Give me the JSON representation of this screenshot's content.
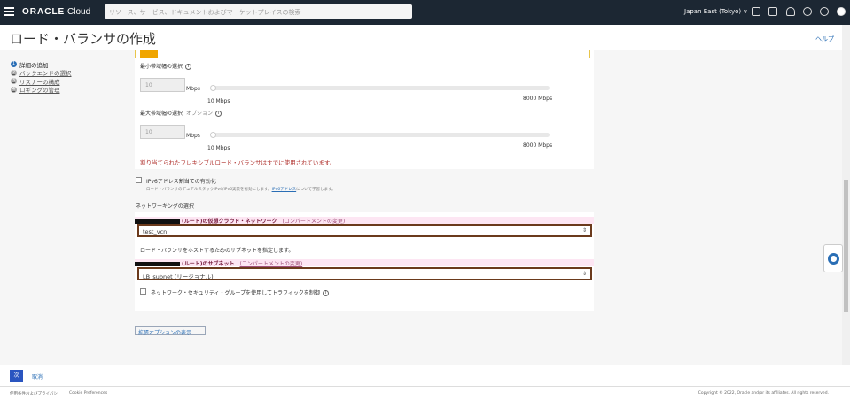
{
  "header": {
    "brand_bold": "ORACLE",
    "brand_light": "Cloud",
    "search_placeholder": "リソース、サービス、ドキュメントおよびマーケットプレイスの検索",
    "region": "Japan East (Tokyo) ∨"
  },
  "page": {
    "title": "ロード・バランサの作成",
    "help": "ヘルプ"
  },
  "steps": [
    {
      "n": "1",
      "label": "詳細の追加"
    },
    {
      "n": "2",
      "label": "バックエンドの選択"
    },
    {
      "n": "3",
      "label": "リスナーの構成"
    },
    {
      "n": "4",
      "label": "ロギングの管理"
    }
  ],
  "bandwidth": {
    "min_label": "最小帯域幅の選択",
    "min_value": "10",
    "unit": "Mbps",
    "min_tick": "10 Mbps",
    "max_tick": "8000 Mbps",
    "max_label": "最大帯域幅の選択",
    "optional": "オプション",
    "max_value": "10",
    "error": "割り当てられたフレキシブルロード・バランサはすでに使用されています。"
  },
  "ipv6": {
    "label": "IPv6アドレス割当ての有効化",
    "desc": "ロード・バランサのデュアルスタックIPv4/IPv6実装を有効にします。",
    "link": "IPv6アドレス",
    "desc_after": "について学習します。"
  },
  "networking": {
    "heading": "ネットワーキングの選択",
    "vcn_label": "(ルート)の仮想クラウド・ネットワーク",
    "change_compartment": "(コンパートメントの変更)",
    "vcn_value": "test_vcn",
    "subnet_hint": "ロード・バランサをホストするためのサブネットを指定します。",
    "subnet_label": "(ルート)のサブネット",
    "subnet_value": "LB_subnet (リージョナル)",
    "nsg_label": "ネットワーク・セキュリティ・グループを使用してトラフィックを制御"
  },
  "advanced": "拡張オプションの表示",
  "actions": {
    "next": "次",
    "cancel": "取消"
  },
  "footer": {
    "terms": "使用条件およびプライバシ",
    "cookies": "Cookie Preferences",
    "copyright": "Copyright © 2022, Oracle and/or its affiliates. All rights reserved."
  }
}
